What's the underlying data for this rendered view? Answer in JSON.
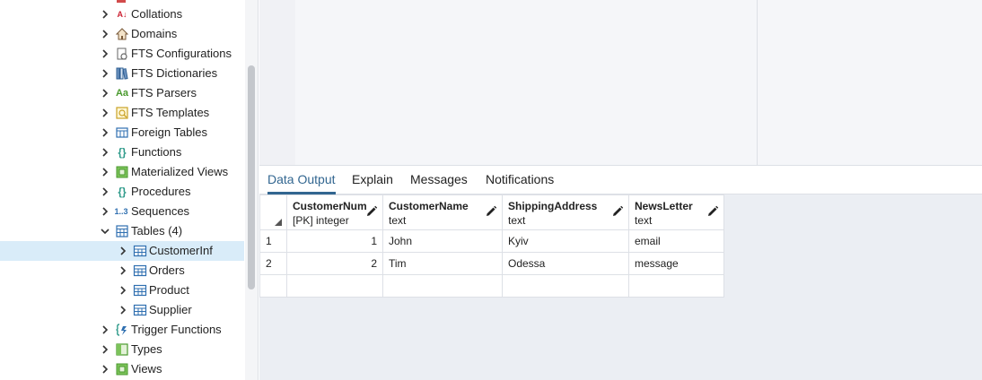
{
  "tree": {
    "items": [
      {
        "label": "Collations",
        "icon": "collations-icon"
      },
      {
        "label": "Domains",
        "icon": "domains-icon"
      },
      {
        "label": "FTS Configurations",
        "icon": "fts-configurations-icon"
      },
      {
        "label": "FTS Dictionaries",
        "icon": "fts-dictionaries-icon"
      },
      {
        "label": "FTS Parsers",
        "icon": "fts-parsers-icon"
      },
      {
        "label": "FTS Templates",
        "icon": "fts-templates-icon"
      },
      {
        "label": "Foreign Tables",
        "icon": "foreign-tables-icon"
      },
      {
        "label": "Functions",
        "icon": "functions-icon"
      },
      {
        "label": "Materialized Views",
        "icon": "materialized-views-icon"
      },
      {
        "label": "Procedures",
        "icon": "procedures-icon"
      },
      {
        "label": "Sequences",
        "icon": "sequences-icon"
      },
      {
        "label": "Tables (4)",
        "icon": "tables-icon"
      },
      {
        "label": "CustomerInf",
        "icon": "table-icon"
      },
      {
        "label": "Orders",
        "icon": "table-icon"
      },
      {
        "label": "Product",
        "icon": "table-icon"
      },
      {
        "label": "Supplier",
        "icon": "table-icon"
      },
      {
        "label": "Trigger Functions",
        "icon": "trigger-functions-icon"
      },
      {
        "label": "Types",
        "icon": "types-icon"
      },
      {
        "label": "Views",
        "icon": "views-icon"
      }
    ],
    "icon_text": {
      "collations": "A↓",
      "fts_parsers": "Aa",
      "sequences": "1..3",
      "functions": "{}",
      "procedures": "{}"
    }
  },
  "result_tabs": [
    "Data Output",
    "Explain",
    "Messages",
    "Notifications"
  ],
  "grid": {
    "columns": [
      {
        "name": "CustomerNum",
        "type": "[PK] integer"
      },
      {
        "name": "CustomerName",
        "type": "text"
      },
      {
        "name": "ShippingAddress",
        "type": "text"
      },
      {
        "name": "NewsLetter",
        "type": "text"
      }
    ],
    "rows": [
      {
        "num": "1",
        "cells": [
          "1",
          "John",
          "Kyiv",
          "email"
        ]
      },
      {
        "num": "2",
        "cells": [
          "2",
          "Tim",
          "Odessa",
          "message"
        ]
      }
    ]
  },
  "colors": {
    "accent": "#326690",
    "selected_row": "#d9ecf9",
    "icon_green": "#4a9a2e",
    "icon_blue": "#2f6fb0",
    "icon_teal": "#2e9a8a"
  }
}
